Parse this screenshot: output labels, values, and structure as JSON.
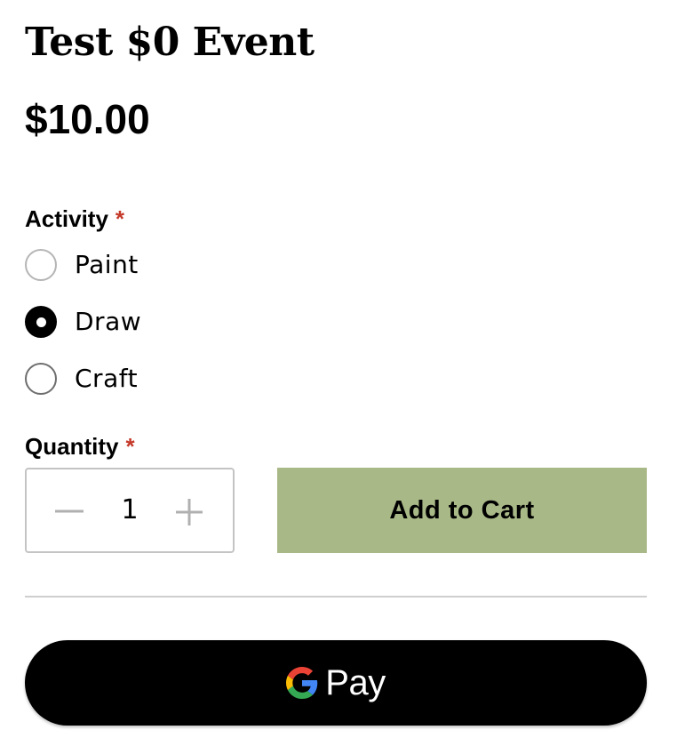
{
  "product": {
    "title": "Test $0 Event",
    "price": "$10.00"
  },
  "activity": {
    "label": "Activity",
    "required_mark": "*",
    "options": [
      {
        "label": "Paint",
        "selected": false
      },
      {
        "label": "Draw",
        "selected": true
      },
      {
        "label": "Craft",
        "selected": false
      }
    ]
  },
  "quantity": {
    "label": "Quantity",
    "required_mark": "*",
    "value": "1",
    "decrement_icon": "minus-icon",
    "increment_icon": "plus-icon"
  },
  "cart": {
    "add_label": "Add to Cart"
  },
  "gpay": {
    "label": "Pay",
    "icon": "google-g-icon"
  },
  "colors": {
    "required": "#c53929",
    "add_to_cart_bg": "#a9b887",
    "gpay_bg": "#000000",
    "radio_selected": "#000000"
  }
}
